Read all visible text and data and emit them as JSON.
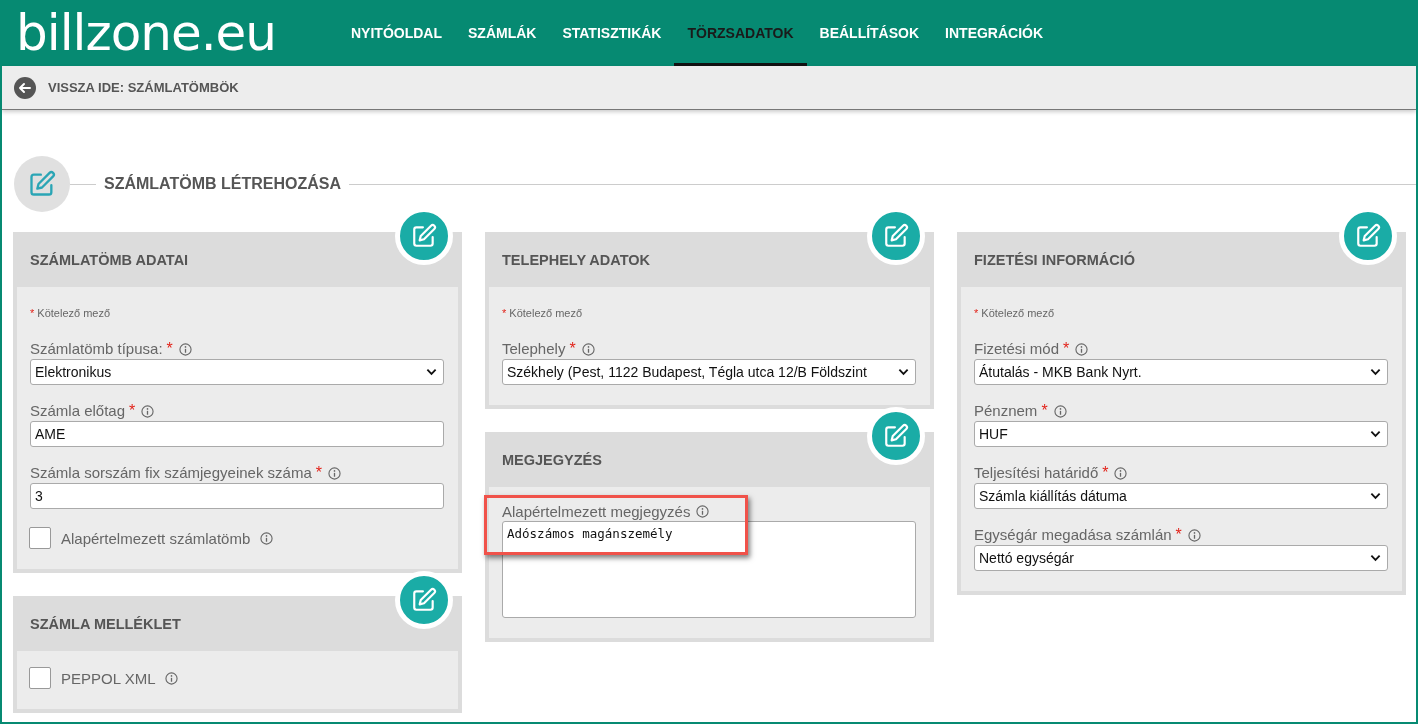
{
  "logo": "billzone.eu",
  "nav": [
    {
      "label": "NYITÓOLDAL",
      "selected": false
    },
    {
      "label": "SZÁMLÁK",
      "selected": false
    },
    {
      "label": "STATISZTIKÁK",
      "selected": false
    },
    {
      "label": "TÖRZSADATOK",
      "selected": true
    },
    {
      "label": "BEÁLLÍTÁSOK",
      "selected": false
    },
    {
      "label": "INTEGRÁCIÓK",
      "selected": false
    }
  ],
  "back_link": "VISSZA IDE: SZÁMLATÖMBÖK",
  "page_title": "SZÁMLATÖMB LÉTREHOZÁSA",
  "columns": [
    [
      {
        "title": "SZÁMLATÖMB ADATAI",
        "required_note": {
          "mark": "*",
          "text": "Kötelező mező"
        },
        "fields": [
          {
            "kind": "select",
            "label": "Számlatömb típusa:",
            "required_mark": "*",
            "value": "Elektronikus"
          },
          {
            "kind": "text",
            "label": "Számla előtag",
            "required_mark": "*",
            "value": "AME"
          },
          {
            "kind": "text",
            "label": "Számla sorszám fix számjegyeinek száma",
            "required_mark": "*",
            "value": "3"
          },
          {
            "kind": "checkbox",
            "label": "Alapértelmezett számlatömb",
            "checked": false
          }
        ]
      },
      {
        "title": "SZÁMLA MELLÉKLET",
        "fields": [
          {
            "kind": "checkbox",
            "label": "PEPPOL XML",
            "checked": false
          }
        ]
      }
    ],
    [
      {
        "title": "TELEPHELY ADATOK",
        "required_note": {
          "mark": "*",
          "text": "Kötelező mező"
        },
        "fields": [
          {
            "kind": "select",
            "label": "Telephely",
            "required_mark": "*",
            "value": "Székhely (Pest, 1122 Budapest, Tégla utca 12/B Földszint"
          }
        ]
      },
      {
        "title": "MEGJEGYZÉS",
        "fields": [
          {
            "kind": "textarea",
            "label": "Alapértelmezett megjegyzés",
            "value": "Adószámos magánszemély",
            "highlighted": true
          }
        ]
      }
    ],
    [
      {
        "title": "FIZETÉSI INFORMÁCIÓ",
        "required_note": {
          "mark": "*",
          "text": "Kötelező mező"
        },
        "fields": [
          {
            "kind": "select",
            "label": "Fizetési mód",
            "required_mark": "*",
            "value": "Átutalás - MKB Bank Nyrt."
          },
          {
            "kind": "select",
            "label": "Pénznem",
            "required_mark": "*",
            "value": "HUF"
          },
          {
            "kind": "select",
            "label": "Teljesítési határidő",
            "required_mark": "*",
            "value": "Számla kiállítás dátuma"
          },
          {
            "kind": "select",
            "label": "Egységár megadása számlán",
            "required_mark": "*",
            "value": "Nettó egységár"
          }
        ]
      }
    ]
  ]
}
